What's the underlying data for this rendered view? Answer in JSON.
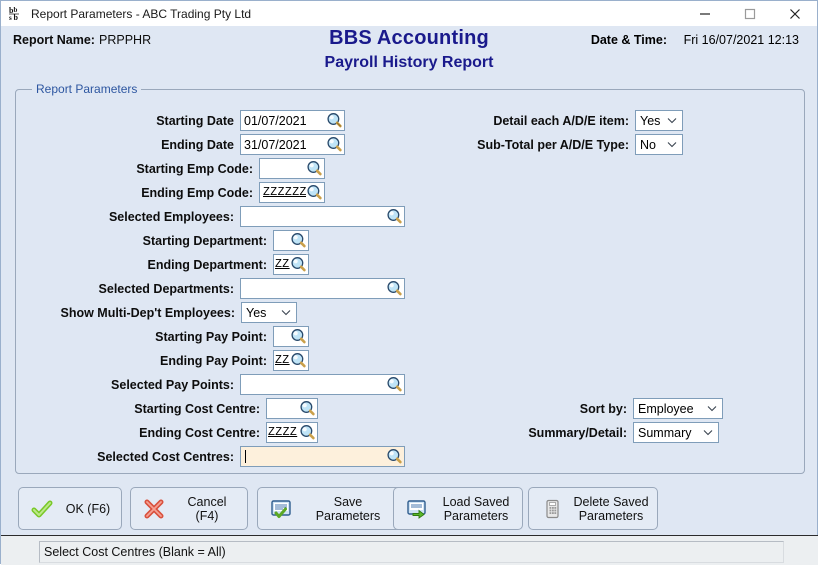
{
  "window": {
    "title": "Report Parameters - ABC Trading Pty Ltd",
    "icon": "bbs-logo-icon",
    "minimize_label": "─",
    "maximize_label": "□",
    "close_label": "✕"
  },
  "header": {
    "report_name_label": "Report Name:",
    "report_name_value": "PRPPHR",
    "app_title": "BBS Accounting",
    "app_subtitle": "Payroll History Report",
    "datetime_label": "Date & Time:",
    "datetime_value": "Fri 16/07/2021 12:13"
  },
  "groupbox": {
    "legend": "Report Parameters"
  },
  "fields": {
    "starting_date": {
      "label": "Starting Date",
      "value": "01/07/2021"
    },
    "ending_date": {
      "label": "Ending Date",
      "value": "31/07/2021"
    },
    "starting_emp_code": {
      "label": "Starting Emp Code:",
      "value": ""
    },
    "ending_emp_code": {
      "label": "Ending Emp Code:",
      "value": "ZZZZZZ"
    },
    "selected_employees": {
      "label": "Selected Employees:",
      "value": ""
    },
    "starting_department": {
      "label": "Starting Department:",
      "value": ""
    },
    "ending_department": {
      "label": "Ending Department:",
      "value": "ZZ"
    },
    "selected_departments": {
      "label": "Selected Departments:",
      "value": ""
    },
    "show_multi_dept": {
      "label": "Show Multi-Dep't Employees:",
      "value": "Yes"
    },
    "starting_pay_point": {
      "label": "Starting Pay Point:",
      "value": ""
    },
    "ending_pay_point": {
      "label": "Ending Pay Point:",
      "value": "ZZ"
    },
    "selected_pay_points": {
      "label": "Selected Pay Points:",
      "value": ""
    },
    "starting_cost_centre": {
      "label": "Starting Cost Centre:",
      "value": ""
    },
    "ending_cost_centre": {
      "label": "Ending Cost Centre:",
      "value": "ZZZZ"
    },
    "selected_cost_centres": {
      "label": "Selected Cost Centres:",
      "value": ""
    },
    "detail_each_ade": {
      "label": "Detail each A/D/E item:",
      "value": "Yes"
    },
    "subtotal_per_ade": {
      "label": "Sub-Total per A/D/E Type:",
      "value": "No"
    },
    "sort_by": {
      "label": "Sort by:",
      "value": "Employee"
    },
    "summary_detail": {
      "label": "Summary/Detail:",
      "value": "Summary"
    }
  },
  "buttons": {
    "ok": {
      "label": "OK (F6)",
      "icon": "green-check-icon"
    },
    "cancel": {
      "label": "Cancel (F4)",
      "icon": "red-x-icon"
    },
    "save_parameters": {
      "label": "Save Parameters",
      "icon": "save-screen-check-icon"
    },
    "load_saved_parameters": {
      "label": "Load Saved\nParameters",
      "icon": "load-screen-arrow-icon"
    },
    "delete_saved_parameters": {
      "label": "Delete Saved\nParameters",
      "icon": "clipboard-icon"
    }
  },
  "statusbar": {
    "text": "Select Cost Centres (Blank = All)"
  },
  "colors": {
    "window_background": "#dfe7f3",
    "title_blue": "#1a1a8c",
    "legend_blue": "#2d56a0",
    "field_border": "#7f9db9",
    "focused_field": "#fdf0dc",
    "button_face": "#e4ebf5"
  }
}
